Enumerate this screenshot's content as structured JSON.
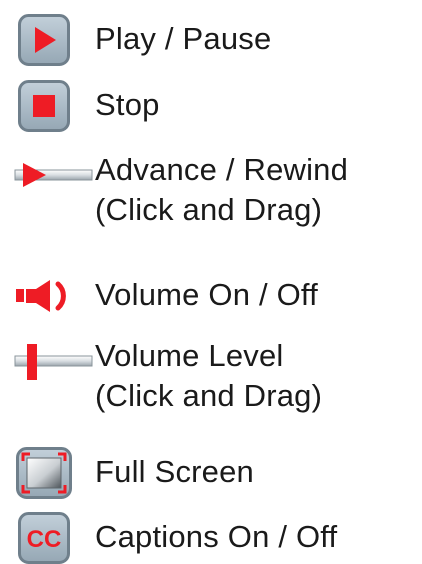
{
  "legend": {
    "items": [
      {
        "icon": "play-icon",
        "label": "Play / Pause"
      },
      {
        "icon": "stop-icon",
        "label": "Stop"
      },
      {
        "icon": "seek-slider-icon",
        "label_line1": "Advance / Rewind",
        "label_line2": "(Click and Drag)"
      },
      {
        "icon": "speaker-icon",
        "label": "Volume On / Off"
      },
      {
        "icon": "volume-slider-icon",
        "label_line1": "Volume Level",
        "label_line2": "(Click and Drag)"
      },
      {
        "icon": "fullscreen-icon",
        "label": "Full Screen"
      },
      {
        "icon": "cc-icon",
        "label": "Captions On / Off",
        "badge_text": "CC"
      }
    ]
  },
  "colors": {
    "accent_red": "#ee1c25",
    "button_bg": "#a7b7c3",
    "button_border": "#6f7f8b",
    "text": "#1a1a1a"
  }
}
